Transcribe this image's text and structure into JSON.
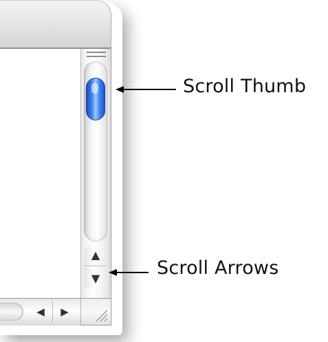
{
  "window": {
    "thumb_color": "#3f83f0",
    "chrome_color": "#e6e6e6"
  },
  "vertical_scrollbar": {
    "grip_icon": "split-grip-icon",
    "up_arrow_glyph": "▲",
    "down_arrow_glyph": "▼",
    "thumb_position": 0.0
  },
  "horizontal_scrollbar": {
    "left_arrow_glyph": "◀",
    "right_arrow_glyph": "▶"
  },
  "resize_corner": {
    "icon": "resize-grip-icon"
  },
  "callouts": {
    "scroll_thumb": "Scroll Thumb",
    "scroll_arrows": "Scroll Arrows"
  }
}
